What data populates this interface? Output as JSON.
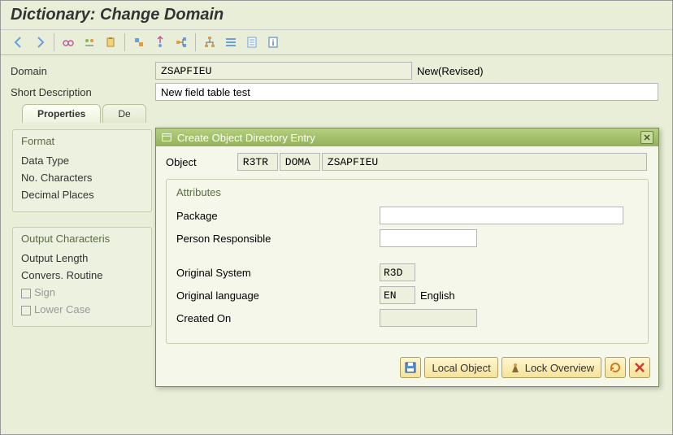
{
  "title": "Dictionary: Change Domain",
  "form": {
    "domain_label": "Domain",
    "domain_value": "ZSAPFIEU",
    "status": "New(Revised)",
    "shortdesc_label": "Short Description",
    "shortdesc_value": "New field table test"
  },
  "tabs": [
    "Properties",
    "De"
  ],
  "groups": {
    "format": {
      "title": "Format",
      "rows": [
        "Data Type",
        "No. Characters",
        "Decimal Places"
      ]
    },
    "output": {
      "title": "Output Characteris",
      "rows": [
        "Output Length",
        "Convers. Routine"
      ],
      "checks": [
        "Sign",
        "Lower Case"
      ]
    }
  },
  "modal": {
    "title": "Create Object Directory Entry",
    "object_label": "Object",
    "object": {
      "f1": "R3TR",
      "f2": "DOMA",
      "f3": "ZSAPFIEU"
    },
    "attributes": {
      "title": "Attributes",
      "package_label": "Package",
      "package_value": "",
      "person_label": "Person Responsible",
      "person_value": "",
      "origsys_label": "Original System",
      "origsys_value": "R3D",
      "origlang_label": "Original language",
      "origlang_value": "EN",
      "origlang_text": "English",
      "created_label": "Created On",
      "created_value": ""
    },
    "buttons": {
      "local": "Local Object",
      "lock": "Lock Overview"
    }
  }
}
